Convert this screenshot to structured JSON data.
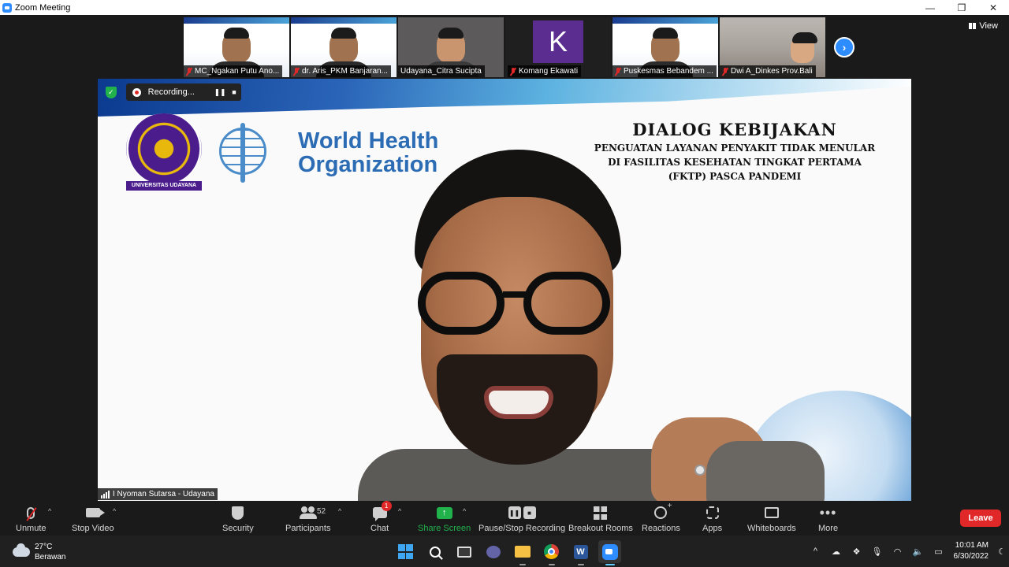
{
  "window": {
    "title": "Zoom Meeting",
    "controls": [
      "—",
      "❐",
      "✕"
    ]
  },
  "gallery": {
    "participants": [
      {
        "name": "MC_Ngakan Putu Ano...",
        "muted": true,
        "type": "slide-video"
      },
      {
        "name": "dr. Aris_PKM Banjaran...",
        "muted": true,
        "type": "slide-video"
      },
      {
        "name": "Udayana_Citra Sucipta",
        "muted": false,
        "type": "video"
      },
      {
        "name": "Komang Ekawati",
        "muted": true,
        "type": "avatar",
        "avatar_letter": "K"
      },
      {
        "name": "Puskesmas Bebandem ...",
        "muted": true,
        "type": "slide-video"
      },
      {
        "name": "Dwi A_Dinkes Prov.Bali",
        "muted": true,
        "type": "room-video"
      }
    ],
    "next_icon": "chevron-right-icon",
    "view_label": "View"
  },
  "recording": {
    "label": "Recording...",
    "pause_icon": "pause-icon",
    "stop_icon": "stop-icon"
  },
  "slide": {
    "university_ribbon": "UNIVERSITAS UDAYANA",
    "who_line1": "World Health",
    "who_line2": "Organization",
    "title": "DIALOG KEBIJAKAN",
    "subtitle_line1": "PENGUATAN LAYANAN PENYAKIT TIDAK MENULAR",
    "subtitle_line2": "DI FASILITAS KESEHATAN TINGKAT PERTAMA",
    "subtitle_line3": "(FKTP) PASCA PANDEMI"
  },
  "active_speaker": {
    "name": "I Nyoman Sutarsa - Udayana"
  },
  "toolbar": {
    "unmute": "Unmute",
    "stop_video": "Stop Video",
    "security": "Security",
    "participants": "Participants",
    "participant_count": "52",
    "chat": "Chat",
    "chat_badge": "1",
    "share_screen": "Share Screen",
    "pause_stop_recording": "Pause/Stop Recording",
    "breakout_rooms": "Breakout Rooms",
    "reactions": "Reactions",
    "apps": "Apps",
    "whiteboards": "Whiteboards",
    "more": "More",
    "leave": "Leave",
    "colors": {
      "leave": "#e02828",
      "share": "#22b24c",
      "accent": "#2d8cff"
    }
  },
  "taskbar": {
    "temperature": "27°C",
    "weather": "Berawan",
    "time": "10:01 AM",
    "date": "6/30/2022"
  }
}
